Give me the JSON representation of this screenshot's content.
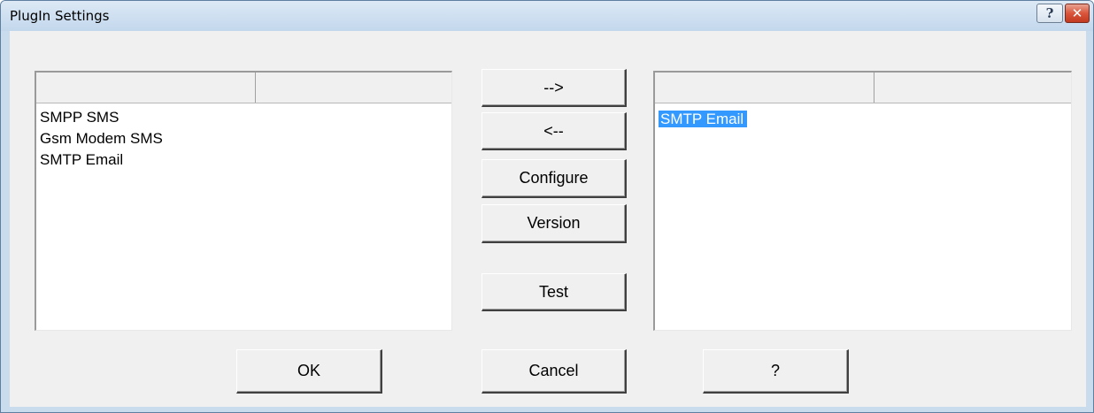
{
  "window": {
    "title": "PlugIn Settings",
    "help_glyph": "?",
    "close_glyph": "✕"
  },
  "available_list": {
    "columns": [
      "",
      ""
    ],
    "items": [
      "SMPP SMS",
      "Gsm Modem SMS",
      "SMTP Email"
    ]
  },
  "selected_list": {
    "columns": [
      "",
      ""
    ],
    "items": [
      "SMTP Email"
    ],
    "selected_item": "SMTP Email"
  },
  "buttons": {
    "add": "-->",
    "remove": "<--",
    "configure": "Configure",
    "version": "Version",
    "test": "Test",
    "ok": "OK",
    "cancel": "Cancel",
    "help": "?"
  },
  "colors": {
    "selection": "#3399ff",
    "title_bar": "#cfe0f1",
    "close_button": "#d9553b"
  }
}
